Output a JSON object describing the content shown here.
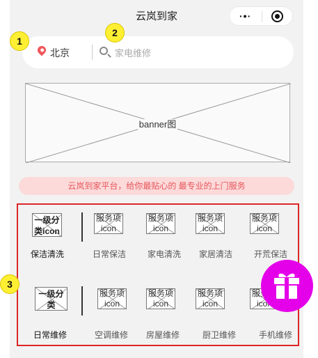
{
  "app": {
    "title": "云岚到家"
  },
  "capsule": {
    "more_icon": "more-dots-icon",
    "close_icon": "target-icon"
  },
  "search": {
    "city": "北京",
    "placeholder": "家电维修"
  },
  "markers": [
    "1",
    "2",
    "3"
  ],
  "banner": {
    "label": "banner图"
  },
  "notice": {
    "text": "云岚到家平台，给你最贴心的 最专业的上门服务"
  },
  "categories": [
    {
      "icon_text": [
        "一级分",
        "类icon"
      ],
      "name": "保洁清洗",
      "services": [
        {
          "icon_text": [
            "服务项",
            "icon"
          ],
          "name": "日常保洁"
        },
        {
          "icon_text": [
            "服务项",
            "icon"
          ],
          "name": "家电清洗"
        },
        {
          "icon_text": [
            "服务项",
            "icon"
          ],
          "name": "家居清洁"
        },
        {
          "icon_text": [
            "服务项",
            "icon"
          ],
          "name": "开荒保洁"
        }
      ]
    },
    {
      "icon_text": [
        "一级分类",
        "icon"
      ],
      "name": "日常维修",
      "services": [
        {
          "icon_text": [
            "服务项",
            "icon"
          ],
          "name": "空调维修"
        },
        {
          "icon_text": [
            "服务项",
            "icon"
          ],
          "name": "房屋维修"
        },
        {
          "icon_text": [
            "服务项",
            "icon"
          ],
          "name": "厨卫维修"
        },
        {
          "icon_text": [
            "服务项",
            "icon"
          ],
          "name": "手机维修"
        }
      ]
    }
  ],
  "colors": {
    "accent_red": "#dc2626",
    "notice_bg": "#fcdada",
    "notice_text": "#e5565b",
    "gift_bg": "#e400e8",
    "marker_yellow": "#ffef33"
  },
  "float_button": {
    "icon": "gift-icon"
  }
}
